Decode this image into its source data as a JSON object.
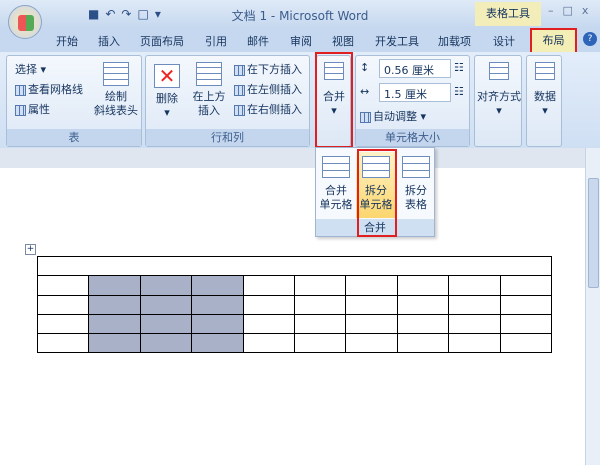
{
  "window": {
    "title": "文档 1 - Microsoft Word",
    "context_label": "表格工具",
    "min": "–",
    "max": "□",
    "close": "x"
  },
  "qat": {
    "save": "■",
    "undo": "↶",
    "redo": "↷",
    "new": "□",
    "more": "▾"
  },
  "tabs": [
    "开始",
    "插入",
    "页面布局",
    "引用",
    "邮件",
    "审阅",
    "视图",
    "开发工具",
    "加载项",
    "设计",
    "布局"
  ],
  "help": "?",
  "ribbon": {
    "table_group": {
      "label": "表",
      "select": "选择 ▾",
      "gridlines": "查看网格线",
      "properties": "属性",
      "draw_diagonal": [
        "绘制",
        "斜线表头"
      ]
    },
    "rows_cols_group": {
      "label": "行和列",
      "delete": "删除",
      "insert_above": [
        "在上方",
        "插入"
      ],
      "insert_below": "在下方插入",
      "insert_left": "在左侧插入",
      "insert_right": "在右侧插入"
    },
    "merge_group": {
      "label": "合并"
    },
    "cell_size_group": {
      "label": "单元格大小",
      "height": "0.56 厘米",
      "width": "1.5 厘米",
      "autofit": "自动调整 ▾"
    },
    "alignment": "对齐方式",
    "data": "数据"
  },
  "dropdown": {
    "merge_cells": [
      "合并",
      "单元格"
    ],
    "split_cells": [
      "拆分",
      "单元格"
    ],
    "split_table": [
      "拆分",
      "表格"
    ],
    "label": "合并"
  },
  "table": {
    "rows": 5,
    "cols": 10,
    "selected": "rows 2-5, cols 2-4"
  }
}
